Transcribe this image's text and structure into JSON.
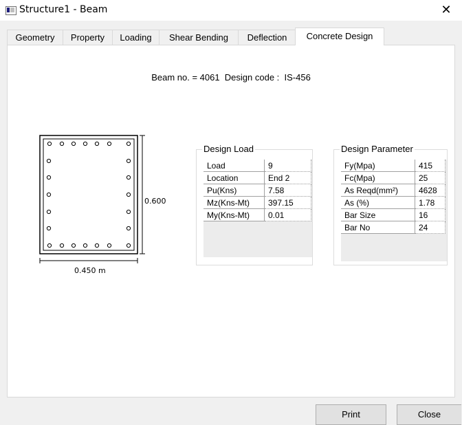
{
  "window": {
    "title": "Structure1 - Beam",
    "close_glyph": "✕"
  },
  "tabs": [
    {
      "label": "Geometry"
    },
    {
      "label": "Property"
    },
    {
      "label": "Loading"
    },
    {
      "label": "Shear Bending"
    },
    {
      "label": "Deflection"
    },
    {
      "label": "Concrete Design",
      "active": true
    }
  ],
  "header_text": "Beam no. = 4061  Design code :  IS-456",
  "section": {
    "height_label": "0.600",
    "width_label": "0.450 m"
  },
  "design_load": {
    "title": "Design Load",
    "rows": [
      {
        "label": "Load",
        "value": "9"
      },
      {
        "label": "Location",
        "value": "End 2"
      },
      {
        "label": "Pu(Kns)",
        "value": "7.58"
      },
      {
        "label": "Mz(Kns-Mt)",
        "value": "397.15"
      },
      {
        "label": "My(Kns-Mt)",
        "value": "0.01"
      }
    ]
  },
  "design_parameter": {
    "title": "Design Parameter",
    "rows": [
      {
        "label": "Fy(Mpa)",
        "value": "415"
      },
      {
        "label": "Fc(Mpa)",
        "value": "25"
      },
      {
        "label": "As Reqd(mm²)",
        "value": "4628"
      },
      {
        "label": "As (%)",
        "value": "1.78"
      },
      {
        "label": "Bar Size",
        "value": "16"
      },
      {
        "label": "Bar No",
        "value": "24"
      }
    ]
  },
  "buttons": {
    "print": "Print",
    "close": "Close"
  }
}
